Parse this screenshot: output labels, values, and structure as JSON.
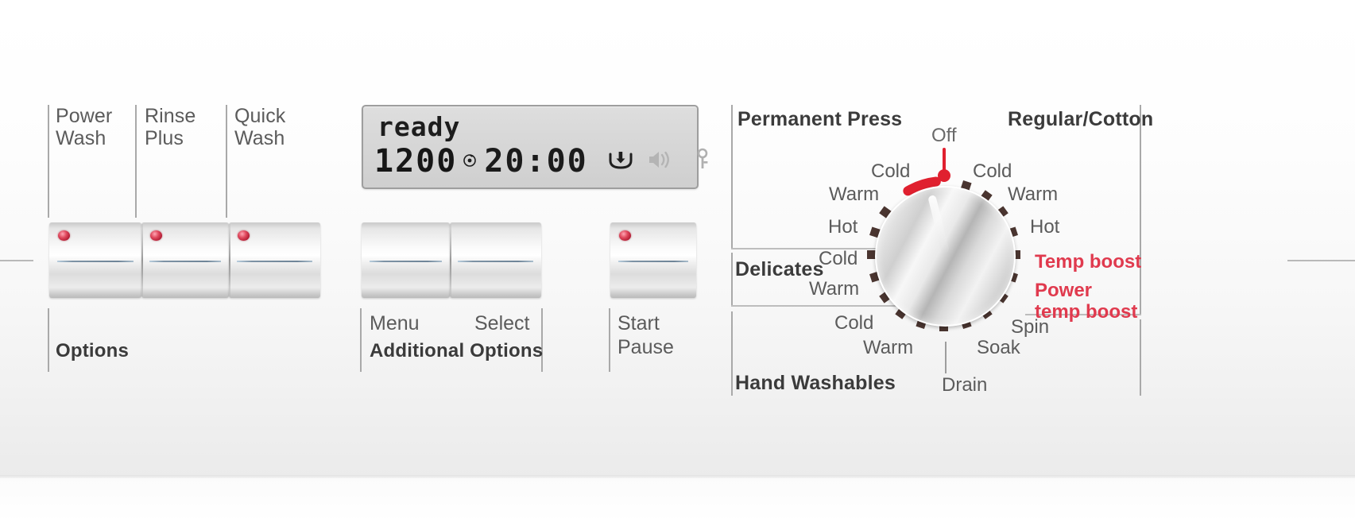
{
  "appliance": {
    "name": "washing-machine-control-panel"
  },
  "options_group": {
    "caption": "Options",
    "buttons": [
      {
        "label": "Power\nWash",
        "led": "on",
        "name": "power-wash"
      },
      {
        "label": "Rinse\nPlus",
        "led": "on",
        "name": "rinse-plus"
      },
      {
        "label": "Quick\nWash",
        "led": "on",
        "name": "quick-wash"
      }
    ]
  },
  "display": {
    "status_text": "ready",
    "spin_speed": "1200",
    "spin_symbol": "⊚",
    "time_remaining": "20:00",
    "icons": [
      {
        "name": "detergent-drawer-icon",
        "state": "active"
      },
      {
        "name": "sound-speaker-icon",
        "state": "inactive"
      },
      {
        "name": "child-lock-key-icon",
        "state": "inactive"
      }
    ]
  },
  "additional_options_group": {
    "caption": "Additional Options",
    "buttons": [
      {
        "label": "Menu",
        "name": "menu"
      },
      {
        "label": "Select",
        "name": "select"
      }
    ]
  },
  "start_group": {
    "caption": "Start\nPause",
    "button": {
      "name": "start-pause",
      "led": "on"
    }
  },
  "dial": {
    "off_label": "Off",
    "selected_position": "Permanent Press - Cold",
    "cycle_groups": [
      {
        "title": "Permanent Press",
        "temperatures": [
          "Cold",
          "Warm",
          "Hot"
        ]
      },
      {
        "title": "Delicates",
        "temperatures": [
          "Cold",
          "Warm"
        ]
      },
      {
        "title": "Hand Washables",
        "temperatures": [
          "Cold",
          "Warm"
        ]
      },
      {
        "title": "Regular/Cotton",
        "temperatures": [
          "Cold",
          "Warm",
          "Hot"
        ],
        "boosts": [
          "Temp boost",
          "Power\ntemp boost"
        ]
      }
    ],
    "utility_positions": [
      "Drain",
      "Soak",
      "Spin"
    ],
    "accent_color": "#e03a4e",
    "tick_color": "#4a3530"
  }
}
